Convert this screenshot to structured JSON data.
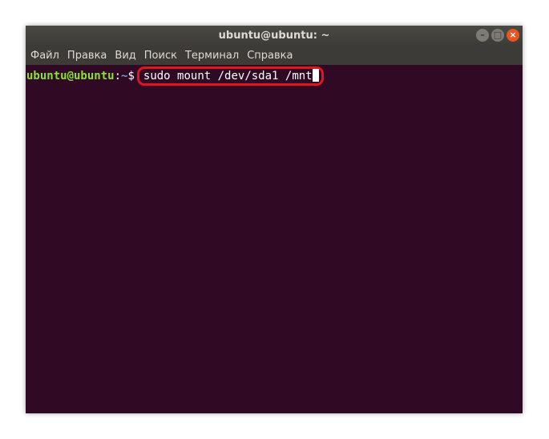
{
  "window": {
    "title": "ubuntu@ubuntu: ~",
    "buttons": {
      "minimize": "–",
      "maximize": "□",
      "close": "×"
    }
  },
  "menu": {
    "items": [
      "Файл",
      "Правка",
      "Вид",
      "Поиск",
      "Терминал",
      "Справка"
    ]
  },
  "terminal": {
    "prompt_user": "ubuntu@ubuntu",
    "prompt_sep": ":",
    "prompt_path": "~",
    "prompt_dollar": "$",
    "command": "sudo mount /dev/sda1 /mnt"
  },
  "colors": {
    "terminal_bg": "#300a24",
    "prompt_user": "#8ae234",
    "prompt_path": "#729fcf",
    "highlight": "#e3141b",
    "close_button": "#e95420"
  },
  "icons": {
    "minimize": "minimize-icon",
    "maximize": "maximize-icon",
    "close": "close-icon"
  }
}
